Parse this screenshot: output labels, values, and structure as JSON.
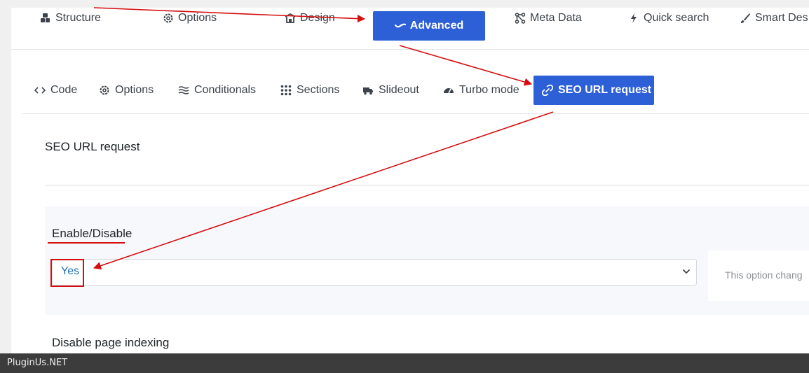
{
  "main_tabs": [
    {
      "label": "Structure",
      "icon": "cubes-icon"
    },
    {
      "label": "Options",
      "icon": "gear-icon"
    },
    {
      "label": "Design",
      "icon": "design-icon"
    },
    {
      "label": "Advanced",
      "icon": "wave-icon",
      "active": true
    },
    {
      "label": "Meta Data",
      "icon": "nodes-icon"
    },
    {
      "label": "Quick search",
      "icon": "bolt-icon"
    },
    {
      "label": "Smart Des",
      "icon": "brush-icon"
    }
  ],
  "sub_tabs": [
    {
      "label": "Code",
      "icon": "code-icon"
    },
    {
      "label": "Options",
      "icon": "gear-icon"
    },
    {
      "label": "Conditionals",
      "icon": "waves-icon"
    },
    {
      "label": "Sections",
      "icon": "grid-icon"
    },
    {
      "label": "Slideout",
      "icon": "truck-icon"
    },
    {
      "label": "Turbo mode",
      "icon": "gauge-icon"
    },
    {
      "label": "SEO URL request",
      "icon": "link-icon",
      "active": true
    }
  ],
  "section": {
    "title": "SEO URL request"
  },
  "option1": {
    "label": "Enable/Disable",
    "value": "Yes",
    "hint": "This option chang"
  },
  "option2": {
    "label": "Disable page indexing"
  },
  "footer": {
    "text": "PluginUs.NET"
  },
  "colors": {
    "accent": "#2d5fd6",
    "annotation": "#d40f0f"
  }
}
